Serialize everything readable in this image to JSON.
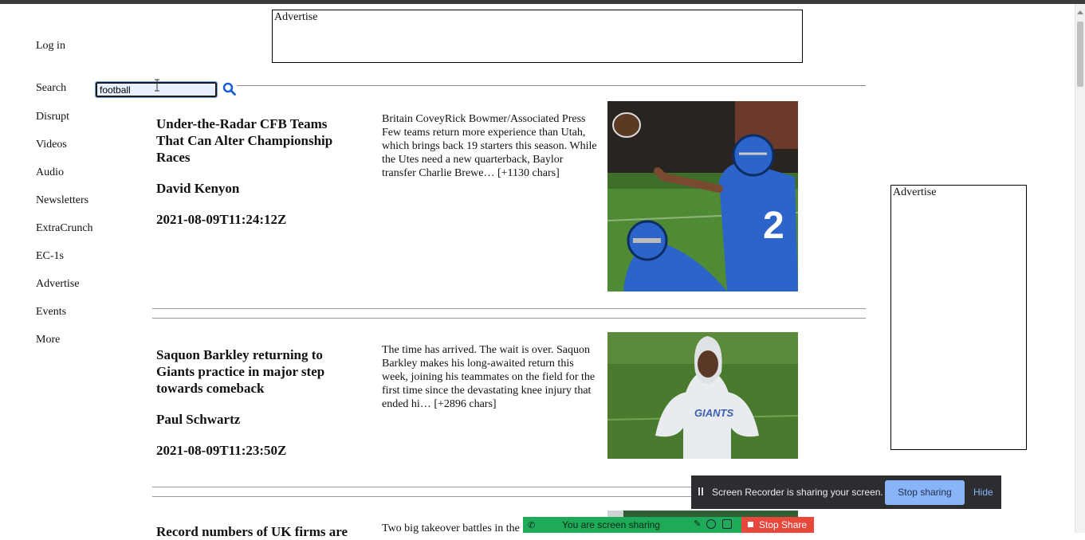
{
  "ads": {
    "top_label": "Advertise",
    "right_label": "Advertise"
  },
  "nav": {
    "login": "Log in",
    "search_label": "Search",
    "search_value": "football",
    "items": [
      "Disrupt",
      "Videos",
      "Audio",
      "Newsletters",
      "ExtraCrunch",
      "EC-1s",
      "Advertise",
      "Events",
      "More"
    ]
  },
  "articles": [
    {
      "title": "Under-the-Radar CFB Teams That Can Alter Championship Races",
      "author": "David Kenyon",
      "date": "2021-08-09T11:24:12Z",
      "description": "Britain CoveyRick Bowmer/Associated Press Few teams return more experience than Utah, which brings back 19 starters this season. While the Utes need a new quarterback, Baylor transfer Charlie Brewe… [+1130 chars]",
      "image_jersey_number": "2"
    },
    {
      "title": "Saquon Barkley returning to Giants practice in major step towards comeback",
      "author": "Paul Schwartz",
      "date": "2021-08-09T11:23:50Z",
      "description": "The time has arrived.  The wait is over. Saquon Barkley makes his long-awaited return this week, joining his teammates on the field for the first time since the devastating knee injury that ended hi… [+2896 chars]",
      "image_shirt_text": "GIANTS"
    },
    {
      "title": "Record numbers of UK firms are",
      "description": "Two big takeover battles in the"
    }
  ],
  "screen_recorder": {
    "message": "Screen Recorder is sharing your screen.",
    "stop_label": "Stop sharing",
    "hide_label": "Hide"
  },
  "share_bar": {
    "message": "You are screen sharing",
    "stop_label": "Stop Share"
  },
  "colors": {
    "link_blue": "#1a5bd6",
    "recorder_bg": "#2b2d30",
    "recorder_button": "#8ab4f8",
    "share_green": "#1eaa59",
    "share_red": "#e8473b",
    "jersey_blue": "#2c64c9",
    "field_green": "#4f8a34"
  }
}
